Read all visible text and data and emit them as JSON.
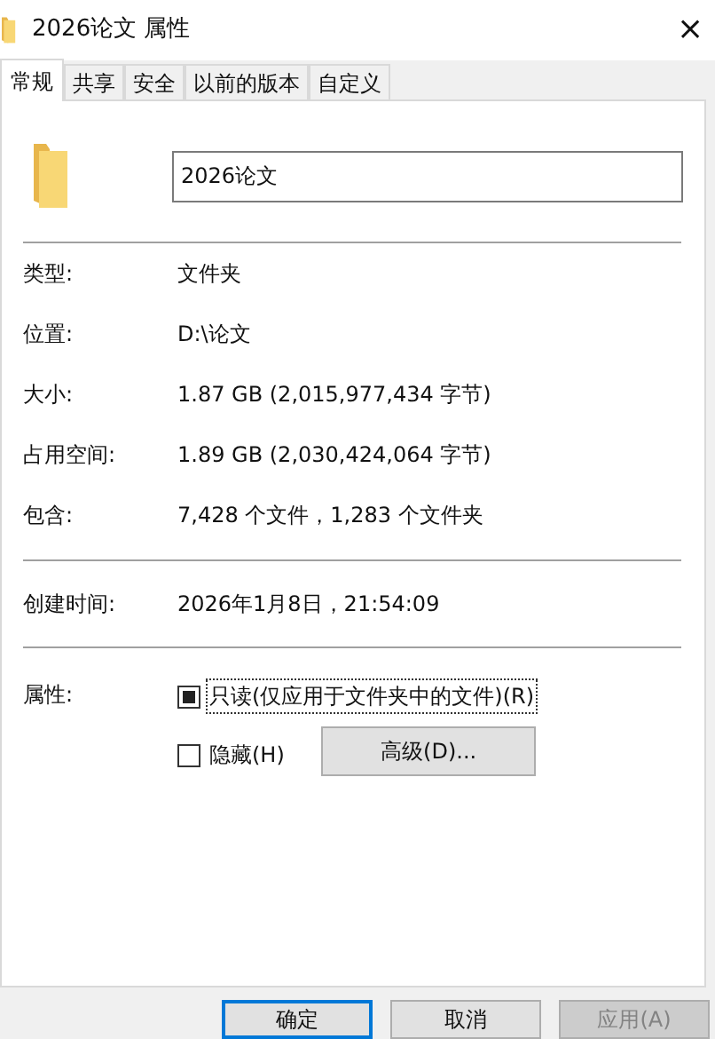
{
  "window": {
    "title": "2026论文 属性",
    "close": "×"
  },
  "tabs": [
    {
      "label": "常规",
      "selected": true
    },
    {
      "label": "共享",
      "selected": false
    },
    {
      "label": "安全",
      "selected": false
    },
    {
      "label": "以前的版本",
      "selected": false
    },
    {
      "label": "自定义",
      "selected": false
    }
  ],
  "name_field": {
    "value": "2026论文"
  },
  "details": [
    {
      "label": "类型:",
      "value": "文件夹"
    },
    {
      "label": "位置:",
      "value": "D:\\论文"
    },
    {
      "label": "大小:",
      "value": "1.87 GB (2,015,977,434 字节)"
    },
    {
      "label": "占用空间:",
      "value": "1.89 GB (2,030,424,064 字节)"
    },
    {
      "label": "包含:",
      "value": "7,428 个文件，1,283 个文件夹"
    }
  ],
  "created": {
    "label": "创建时间:",
    "value": "2026年1月8日，21:54:09"
  },
  "attributes": {
    "label": "属性:",
    "options": [
      {
        "label": "只读(仅应用于文件夹中的文件)(R)",
        "checked": false,
        "indeterminate": true,
        "focused": true
      },
      {
        "label": "隐藏(H)",
        "checked": false,
        "indeterminate": false,
        "focused": false
      }
    ],
    "advanced_button": "高级(D)..."
  },
  "buttons": [
    {
      "label": "确定",
      "default": true,
      "disabled": false
    },
    {
      "label": "取消",
      "default": false,
      "disabled": false
    },
    {
      "label": "应用(A)",
      "default": false,
      "disabled": true
    }
  ]
}
